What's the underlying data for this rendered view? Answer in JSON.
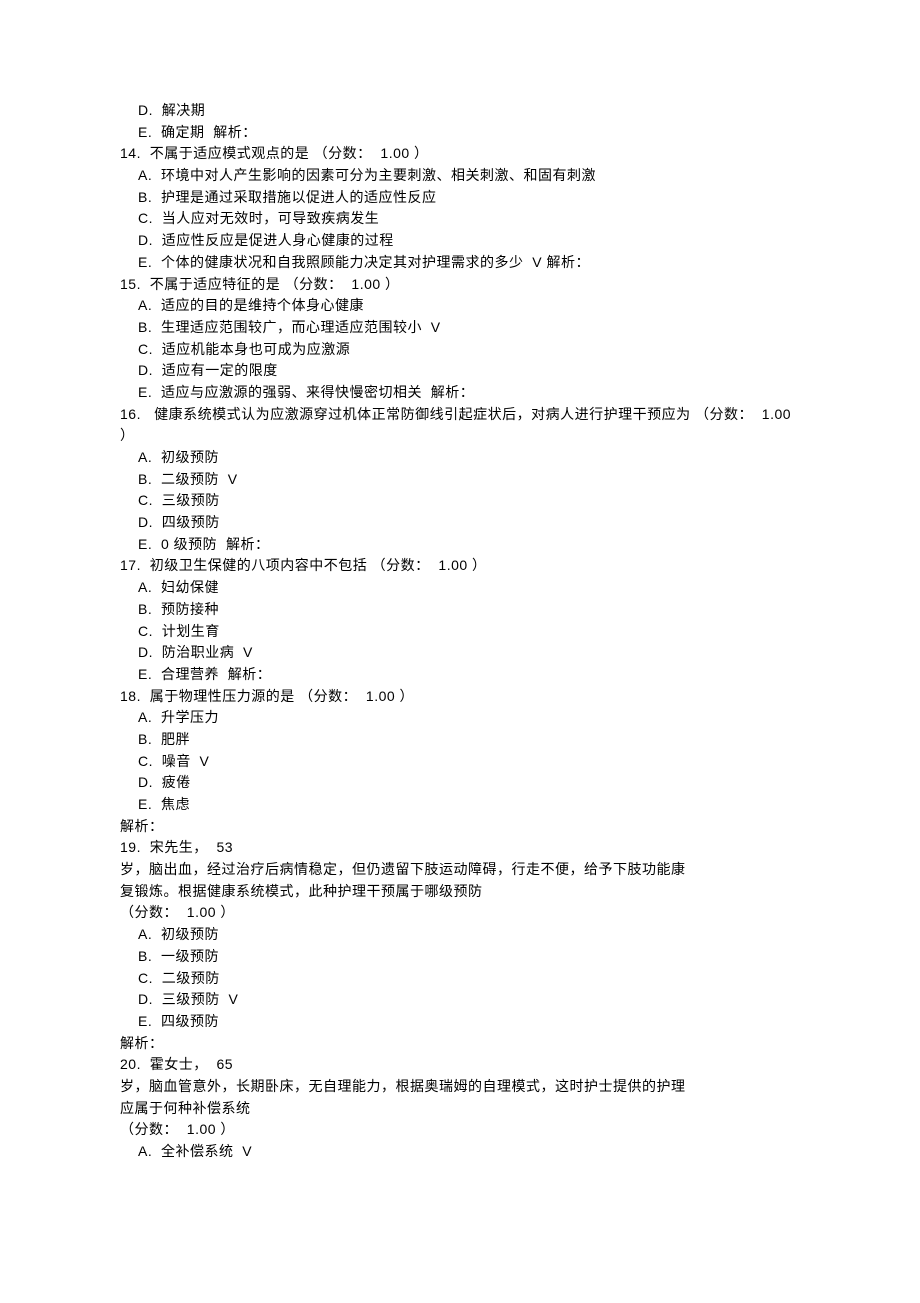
{
  "lines": [
    {
      "cls": "opt",
      "text": "D.  解决期"
    },
    {
      "cls": "opt",
      "text": "E.  确定期  解析："
    },
    {
      "cls": "q",
      "text": "14.  不属于适应模式观点的是 （分数：  1.00 ）"
    },
    {
      "cls": "opt",
      "text": "A.  环境中对人产生影响的因素可分为主要刺激、相关刺激、和固有刺激"
    },
    {
      "cls": "opt",
      "text": "B.  护理是通过采取措施以促进人的适应性反应"
    },
    {
      "cls": "opt",
      "text": "C.  当人应对无效时，可导致疾病发生"
    },
    {
      "cls": "opt",
      "text": "D.  适应性反应是促进人身心健康的过程"
    },
    {
      "cls": "opt",
      "text": "E.  个体的健康状况和自我照顾能力决定其对护理需求的多少  V 解析："
    },
    {
      "cls": "q",
      "text": "15.  不属于适应特征的是 （分数：  1.00 ）"
    },
    {
      "cls": "opt",
      "text": "A.  适应的目的是维持个体身心健康"
    },
    {
      "cls": "opt",
      "text": "B.  生理适应范围较广，而心理适应范围较小  V"
    },
    {
      "cls": "opt",
      "text": "C.  适应机能本身也可成为应激源"
    },
    {
      "cls": "opt",
      "text": "D.  适应有一定的限度"
    },
    {
      "cls": "opt",
      "text": "E.  适应与应激源的强弱、来得快慢密切相关  解析："
    },
    {
      "cls": "q",
      "text": "16.   健康系统模式认为应激源穿过机体正常防御线引起症状后，对病人进行护理干预应为 （分数：  1.00"
    },
    {
      "cls": "q",
      "text": "）"
    },
    {
      "cls": "opt",
      "text": "A.  初级预防"
    },
    {
      "cls": "opt",
      "text": "B.  二级预防  V"
    },
    {
      "cls": "opt",
      "text": "C.  三级预防"
    },
    {
      "cls": "opt",
      "text": "D.  四级预防"
    },
    {
      "cls": "opt",
      "text": "E.  0 级预防  解析："
    },
    {
      "cls": "q",
      "text": "17.  初级卫生保健的八项内容中不包括 （分数：  1.00 ）"
    },
    {
      "cls": "opt",
      "text": "A.  妇幼保健"
    },
    {
      "cls": "opt",
      "text": "B.  预防接种"
    },
    {
      "cls": "opt",
      "text": "C.  计划生育"
    },
    {
      "cls": "opt",
      "text": "D.  防治职业病  V"
    },
    {
      "cls": "opt",
      "text": "E.  合理营养  解析："
    },
    {
      "cls": "q",
      "text": "18.  属于物理性压力源的是 （分数：  1.00 ）"
    },
    {
      "cls": "opt",
      "text": "A.  升学压力"
    },
    {
      "cls": "opt",
      "text": "B.  肥胖"
    },
    {
      "cls": "opt",
      "text": "C.  噪音  V"
    },
    {
      "cls": "opt",
      "text": "D.  疲倦"
    },
    {
      "cls": "opt",
      "text": "E.  焦虑"
    },
    {
      "cls": "q",
      "text": "解析："
    },
    {
      "cls": "q",
      "text": "19.  宋先生，  53"
    },
    {
      "cls": "q",
      "text": "岁，脑出血，经过治疗后病情稳定，但仍遗留下肢运动障碍，行走不便，给予下肢功能康"
    },
    {
      "cls": "q",
      "text": "复锻炼。根据健康系统模式，此种护理干预属于哪级预防"
    },
    {
      "cls": "q",
      "text": "（分数：  1.00 ）"
    },
    {
      "cls": "opt",
      "text": "A.  初级预防"
    },
    {
      "cls": "opt",
      "text": "B.  一级预防"
    },
    {
      "cls": "opt",
      "text": "C.  二级预防"
    },
    {
      "cls": "opt",
      "text": "D.  三级预防  V"
    },
    {
      "cls": "opt",
      "text": "E.  四级预防"
    },
    {
      "cls": "q",
      "text": "解析："
    },
    {
      "cls": "q",
      "text": "20.  霍女士，  65"
    },
    {
      "cls": "q",
      "text": "岁，脑血管意外，长期卧床，无自理能力，根据奥瑞姆的自理模式，这时护士提供的护理"
    },
    {
      "cls": "q",
      "text": "应属于何种补偿系统"
    },
    {
      "cls": "q",
      "text": "（分数：  1.00 ）"
    },
    {
      "cls": "opt",
      "text": "A.  全补偿系统  V"
    }
  ]
}
